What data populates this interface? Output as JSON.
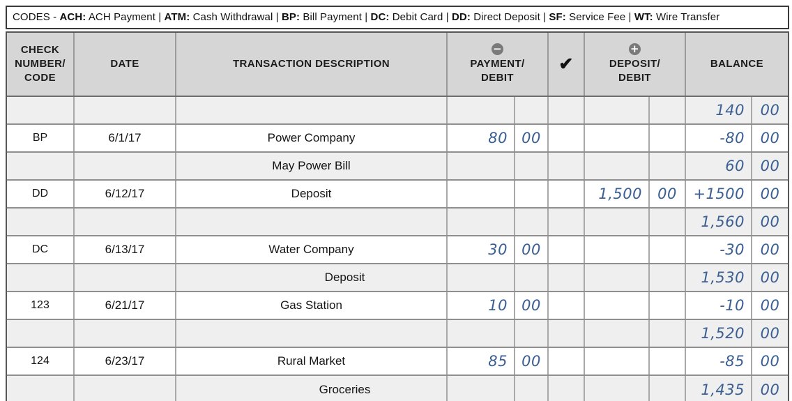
{
  "codes_legend": {
    "prefix": "CODES - ",
    "item_separator": " | ",
    "items": [
      {
        "code": "ACH:",
        "label": "ACH Payment"
      },
      {
        "code": "ATM:",
        "label": "Cash Withdrawal"
      },
      {
        "code": "BP:",
        "label": "Bill Payment"
      },
      {
        "code": "DC:",
        "label": "Debit Card"
      },
      {
        "code": "DD:",
        "label": "Direct Deposit"
      },
      {
        "code": "SF:",
        "label": "Service Fee"
      },
      {
        "code": "WT:",
        "label": "Wire Transfer"
      }
    ]
  },
  "table_header": {
    "check_code": "CHECK\nNUMBER/\nCODE",
    "date": "DATE",
    "description": "TRANSACTION DESCRIPTION",
    "payment": "PAYMENT/\nDEBIT",
    "payment_icon": "−",
    "check_mark": "✔",
    "deposit": "DEPOSIT/\nDEBIT",
    "deposit_icon": "+",
    "balance": "BALANCE"
  },
  "ledger": {
    "rows": [
      {
        "shade": "gray",
        "memo": false,
        "code": "",
        "date": "",
        "desc": "",
        "pay_d": "",
        "pay_c": "",
        "chk": "",
        "dep_d": "",
        "dep_c": "",
        "bal_d": "140",
        "bal_c": "00"
      },
      {
        "shade": "white",
        "memo": false,
        "code": "BP",
        "date": "6/1/17",
        "desc": "Power Company",
        "pay_d": "80",
        "pay_c": "00",
        "chk": "",
        "dep_d": "",
        "dep_c": "",
        "bal_d": "-80",
        "bal_c": "00"
      },
      {
        "shade": "gray",
        "memo": false,
        "code": "",
        "date": "",
        "desc": "May Power Bill",
        "pay_d": "",
        "pay_c": "",
        "chk": "",
        "dep_d": "",
        "dep_c": "",
        "bal_d": "60",
        "bal_c": "00"
      },
      {
        "shade": "white",
        "memo": false,
        "code": "DD",
        "date": "6/12/17",
        "desc": "Deposit",
        "pay_d": "",
        "pay_c": "",
        "chk": "",
        "dep_d": "1,500",
        "dep_c": "00",
        "bal_d": "+1500",
        "bal_c": "00"
      },
      {
        "shade": "gray",
        "memo": false,
        "code": "",
        "date": "",
        "desc": "",
        "pay_d": "",
        "pay_c": "",
        "chk": "",
        "dep_d": "",
        "dep_c": "",
        "bal_d": "1,560",
        "bal_c": "00"
      },
      {
        "shade": "white",
        "memo": false,
        "code": "DC",
        "date": "6/13/17",
        "desc": "Water Company",
        "pay_d": "30",
        "pay_c": "00",
        "chk": "",
        "dep_d": "",
        "dep_c": "",
        "bal_d": "-30",
        "bal_c": "00"
      },
      {
        "shade": "gray",
        "memo": true,
        "code": "",
        "date": "",
        "desc": "Deposit",
        "pay_d": "",
        "pay_c": "",
        "chk": "",
        "dep_d": "",
        "dep_c": "",
        "bal_d": "1,530",
        "bal_c": "00"
      },
      {
        "shade": "white",
        "memo": false,
        "code": "123",
        "date": "6/21/17",
        "desc": "Gas Station",
        "pay_d": "10",
        "pay_c": "00",
        "chk": "",
        "dep_d": "",
        "dep_c": "",
        "bal_d": "-10",
        "bal_c": "00"
      },
      {
        "shade": "gray",
        "memo": false,
        "code": "",
        "date": "",
        "desc": "",
        "pay_d": "",
        "pay_c": "",
        "chk": "",
        "dep_d": "",
        "dep_c": "",
        "bal_d": "1,520",
        "bal_c": "00"
      },
      {
        "shade": "white",
        "memo": false,
        "code": "124",
        "date": "6/23/17",
        "desc": "Rural Market",
        "pay_d": "85",
        "pay_c": "00",
        "chk": "",
        "dep_d": "",
        "dep_c": "",
        "bal_d": "-85",
        "bal_c": "00"
      },
      {
        "shade": "gray",
        "memo": true,
        "code": "",
        "date": "",
        "desc": "Groceries",
        "pay_d": "",
        "pay_c": "",
        "chk": "",
        "dep_d": "",
        "dep_c": "",
        "bal_d": "1,435",
        "bal_c": "00"
      }
    ]
  },
  "colors": {
    "ink": "#3b5f92",
    "stripe": "#efefef",
    "header_bg": "#d6d6d6"
  }
}
